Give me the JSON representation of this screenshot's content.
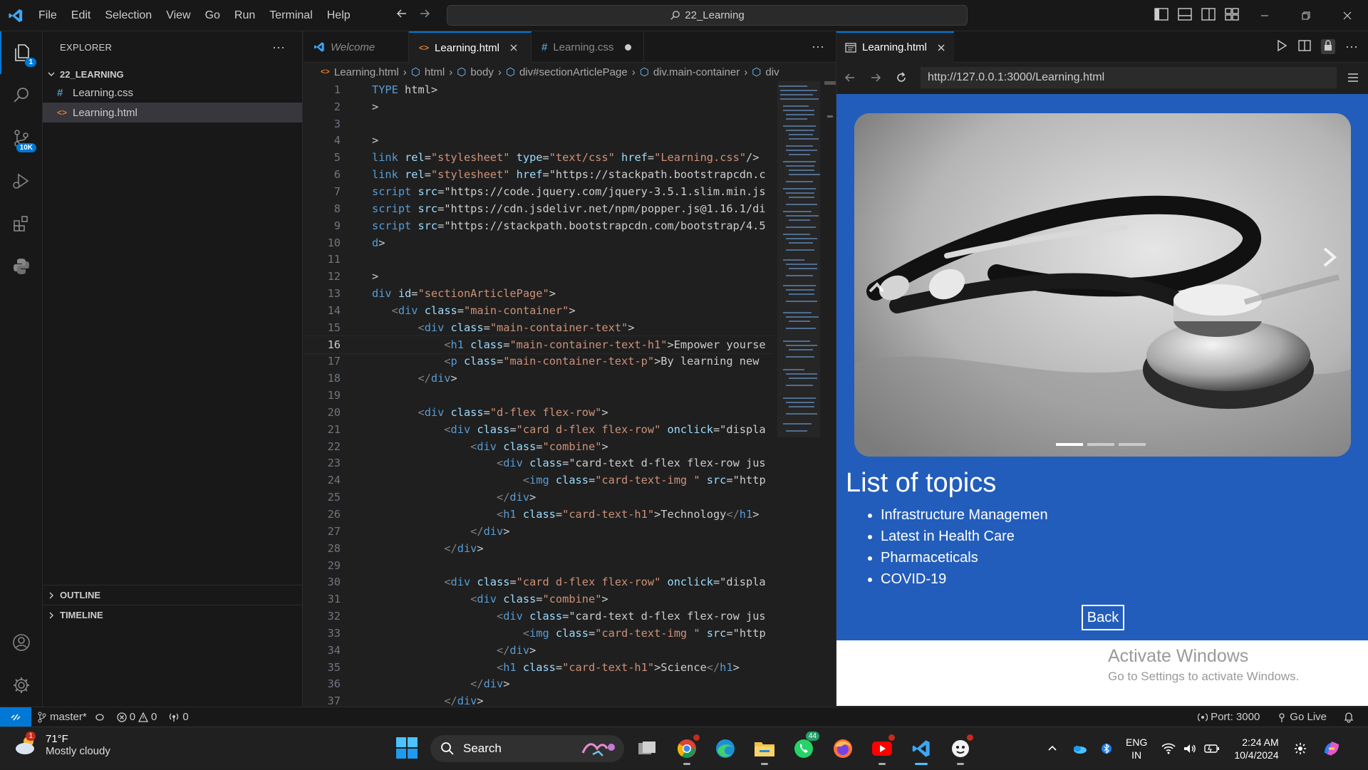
{
  "titlebar": {
    "menu": [
      "File",
      "Edit",
      "Selection",
      "View",
      "Go",
      "Run",
      "Terminal",
      "Help"
    ],
    "command_center": "22_Learning"
  },
  "activity": {
    "explorer_badge": "1",
    "scm_badge": "10K"
  },
  "sidebar": {
    "title": "EXPLORER",
    "folder": "22_LEARNING",
    "files": [
      {
        "name": "Learning.css",
        "icon": "#",
        "icon_color": "#519aba"
      },
      {
        "name": "Learning.html",
        "icon": "<>",
        "icon_color": "#e37933"
      }
    ],
    "outline": "OUTLINE",
    "timeline": "TIMELINE"
  },
  "editor": {
    "tabs": [
      {
        "label": "Welcome"
      },
      {
        "label": "Learning.html"
      },
      {
        "label": "Learning.css"
      }
    ],
    "breadcrumb": [
      "Learning.html",
      "html",
      "body",
      "div#sectionArticlePage",
      "div.main-container",
      "div"
    ],
    "current_line": 16,
    "lines": [
      "TYPE html>",
      ">",
      "",
      ">",
      "link rel=\"stylesheet\" type=\"text/css\" href=\"Learning.css\"/>",
      "link rel=\"stylesheet\" href=\"https://stackpath.bootstrapcdn.c",
      "script src=\"https://code.jquery.com/jquery-3.5.1.slim.min.js",
      "script src=\"https://cdn.jsdelivr.net/npm/popper.js@1.16.1/di",
      "script src=\"https://stackpath.bootstrapcdn.com/bootstrap/4.5",
      "d>",
      "",
      ">",
      "div id=\"sectionArticlePage\">",
      "   <div class=\"main-container\">",
      "       <div class=\"main-container-text\">",
      "           <h1 class=\"main-container-text-h1\">Empower yourse",
      "           <p class=\"main-container-text-p\">By learning new",
      "       </div>",
      "",
      "       <div class=\"d-flex flex-row\">",
      "           <div class=\"card d-flex flex-row\" onclick=\"displa",
      "               <div class=\"combine\">",
      "                   <div class=\"card-text d-flex flex-row jus",
      "                       <img class=\"card-text-img \" src=\"http",
      "                   </div>",
      "                   <h1 class=\"card-text-h1\">Technology</h1>",
      "               </div>",
      "           </div>",
      "",
      "           <div class=\"card d-flex flex-row\" onclick=\"displa",
      "               <div class=\"combine\">",
      "                   <div class=\"card-text d-flex flex-row jus",
      "                       <img class=\"card-text-img \" src=\"http",
      "                   </div>",
      "                   <h1 class=\"card-text-h1\">Science</h1>",
      "               </div>",
      "           </div>"
    ]
  },
  "preview": {
    "tab_label": "Learning.html",
    "url": "http://127.0.0.1:3000/Learning.html",
    "page_bg": "#235dbb",
    "topics_title": "List of topics",
    "topics": [
      "Infrastructure Managemen",
      "Latest in Health Care",
      "Pharmaceticals",
      "COVID-19"
    ],
    "back_label": "Back",
    "watermark_title": "Activate Windows",
    "watermark_sub": "Go to Settings to activate Windows."
  },
  "statusbar": {
    "branch": "master*",
    "errors": "0",
    "warnings": "0",
    "ports": "0",
    "port": "Port: 3000",
    "golive": "Go Live"
  },
  "taskbar": {
    "temp": "71°F",
    "weather": "Mostly cloudy",
    "weather_badge": "1",
    "search_placeholder": "Search",
    "whatsapp_badge": "44",
    "lang_1": "ENG",
    "lang_2": "IN",
    "time": "2:24 AM",
    "date": "10/4/2024"
  },
  "colors": {
    "accent": "#0078d4",
    "keyword": "#569cd6",
    "string": "#ce9178",
    "attribute": "#9cdcfe"
  }
}
